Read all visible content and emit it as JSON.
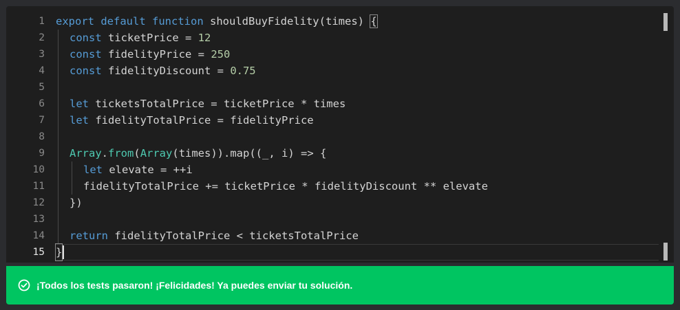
{
  "editor": {
    "line_numbers": [
      "1",
      "2",
      "3",
      "4",
      "5",
      "6",
      "7",
      "8",
      "9",
      "10",
      "11",
      "12",
      "13",
      "14",
      "15"
    ],
    "active_line": "15",
    "code": {
      "l1": {
        "kw1": "export",
        "kw2": "default",
        "kw3": "function",
        "name": " shouldBuyFidelity",
        "rest": "(times) ",
        "brace": "{"
      },
      "l2": {
        "kw": "const",
        "rest": " ticketPrice = ",
        "num": "12"
      },
      "l3": {
        "kw": "const",
        "rest": " fidelityPrice = ",
        "num": "250"
      },
      "l4": {
        "kw": "const",
        "rest": " fidelityDiscount = ",
        "num": "0.75"
      },
      "l6": {
        "kw": "let",
        "rest": " ticketsTotalPrice = ticketPrice * times"
      },
      "l7": {
        "kw": "let",
        "rest": " fidelityTotalPrice = fidelityPrice"
      },
      "l9": {
        "type1": "Array",
        "dot": ".",
        "fn": "from",
        "p1": "(",
        "type2": "Array",
        "rest": "(times)).map((_, i) => {"
      },
      "l10": {
        "kw": "let",
        "rest": " elevate = ++i"
      },
      "l11": {
        "text": "fidelityTotalPrice += ticketPrice * fidelityDiscount ** elevate"
      },
      "l12": {
        "text": "})"
      },
      "l14": {
        "kw": "return",
        "rest": " fidelityTotalPrice < ticketsTotalPrice"
      },
      "l15": {
        "text": "}"
      }
    }
  },
  "banner": {
    "message": "¡Todos los tests pasaron! ¡Felicidades! Ya puedes enviar tu solución.",
    "status_color": "#00c561",
    "icon": "check-circle-icon"
  }
}
